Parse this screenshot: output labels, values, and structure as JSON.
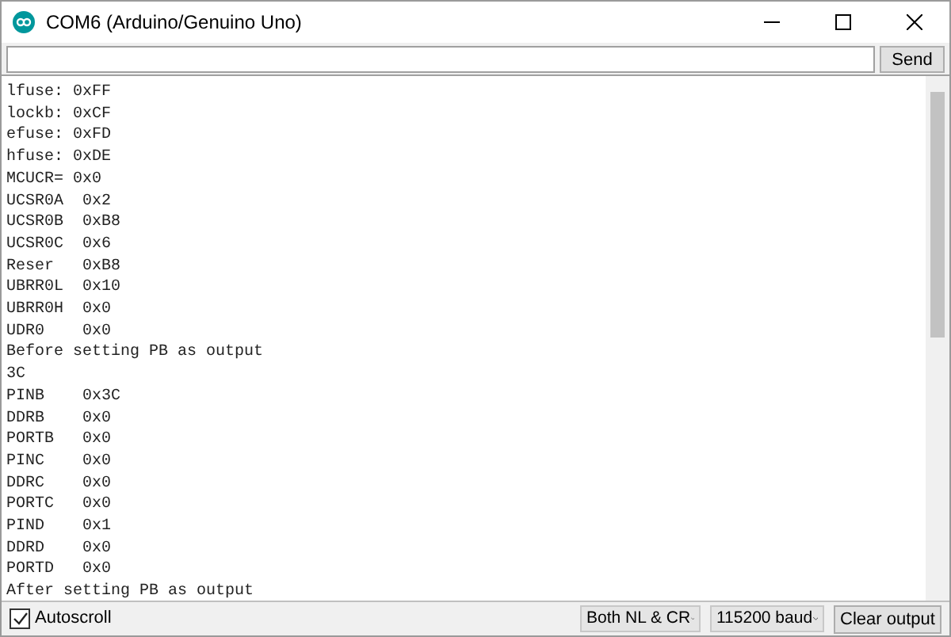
{
  "window": {
    "title": "COM6 (Arduino/Genuino Uno)"
  },
  "send_button": {
    "label": "Send"
  },
  "output_lines": [
    "lfuse: 0xFF",
    "lockb: 0xCF",
    "efuse: 0xFD",
    "hfuse: 0xDE",
    "MCUCR= 0x0",
    "UCSR0A  0x2",
    "UCSR0B  0xB8",
    "UCSR0C  0x6",
    "Reser   0xB8",
    "UBRR0L  0x10",
    "UBRR0H  0x0",
    "UDR0    0x0",
    "Before setting PB as output",
    "3C",
    "PINB    0x3C",
    "DDRB    0x0",
    "PORTB   0x0",
    "PINC    0x0",
    "DDRC    0x0",
    "PORTC   0x0",
    "PIND    0x1",
    "DDRD    0x0",
    "PORTD   0x0",
    "After setting PB as output"
  ],
  "autoscroll": {
    "label": "Autoscroll",
    "checked": true
  },
  "line_ending": {
    "value": "Both NL & CR"
  },
  "baud_rate": {
    "value": "115200 baud"
  },
  "clear_button": {
    "label": "Clear output"
  }
}
